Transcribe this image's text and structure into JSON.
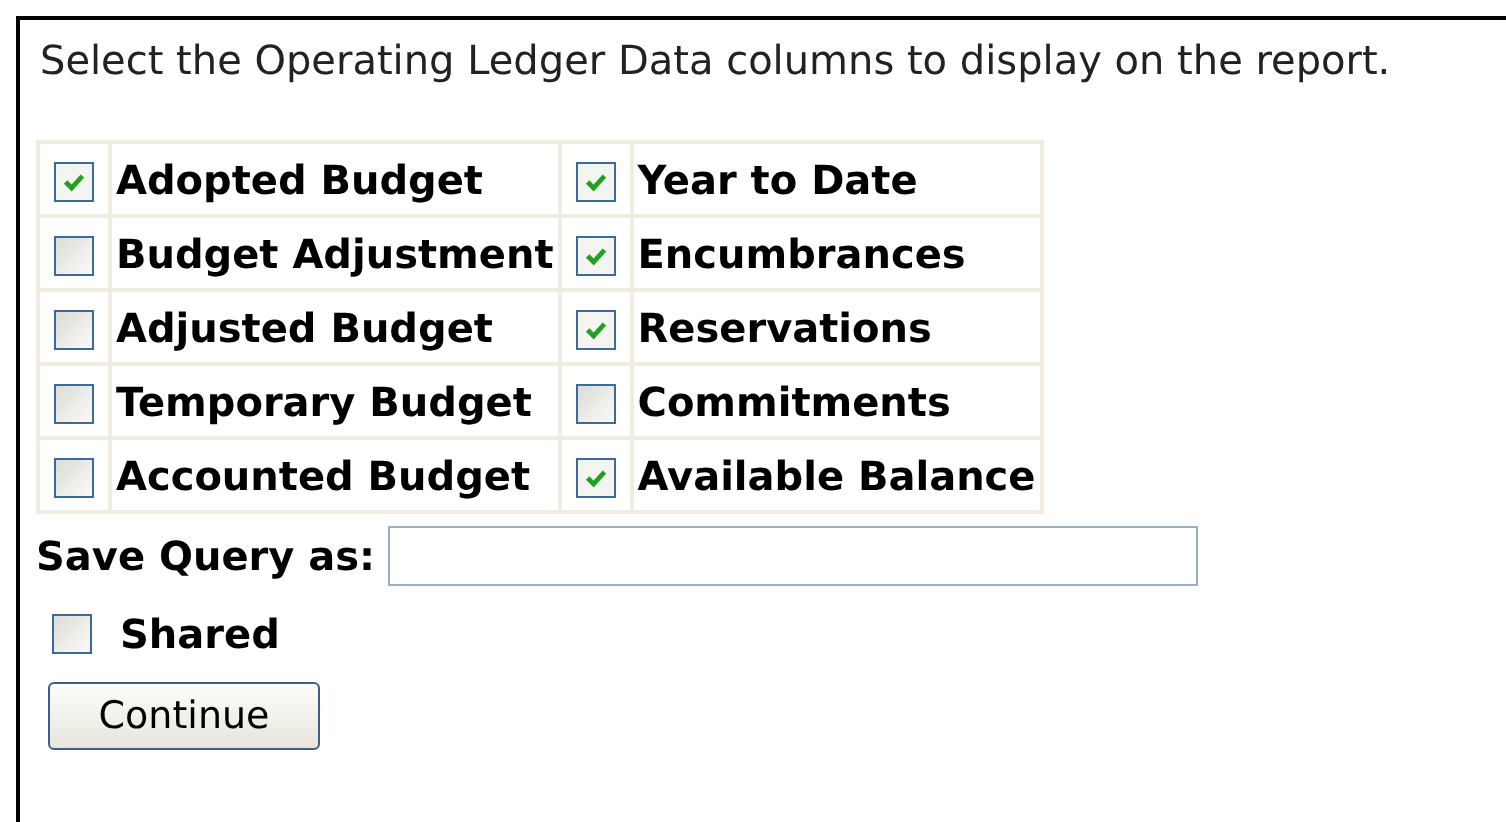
{
  "instruction": "Select the Operating Ledger Data columns to display on the report.",
  "columns": [
    {
      "label": "Adopted Budget",
      "checked": true
    },
    {
      "label": "Year to Date",
      "checked": true
    },
    {
      "label": "Budget Adjustment",
      "checked": false
    },
    {
      "label": "Encumbrances",
      "checked": true
    },
    {
      "label": "Adjusted Budget",
      "checked": false
    },
    {
      "label": "Reservations",
      "checked": true
    },
    {
      "label": "Temporary Budget",
      "checked": false
    },
    {
      "label": "Commitments",
      "checked": false
    },
    {
      "label": "Accounted Budget",
      "checked": false
    },
    {
      "label": "Available Balance",
      "checked": true
    }
  ],
  "save_query": {
    "label": "Save Query as:"
  },
  "shared": {
    "label": "Shared",
    "checked": false
  },
  "buttons": [
    "Continue"
  ]
}
